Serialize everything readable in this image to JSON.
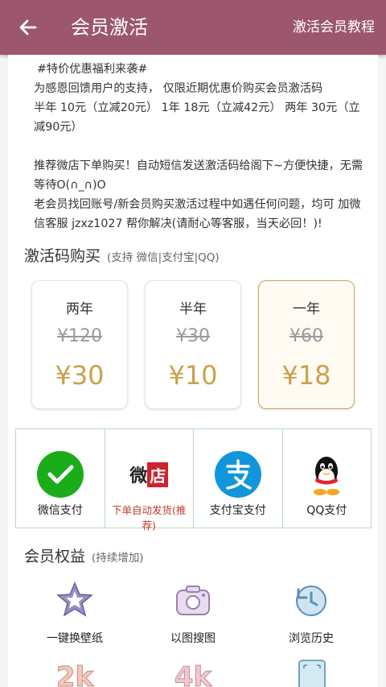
{
  "header": {
    "title": "会员激活",
    "tutorial_label": "激活会员教程"
  },
  "notice": {
    "lines": [
      "#特价优惠福利来袭#",
      "为感恩回馈用户的支持， 仅限近期优惠价购买会员激活码",
      "半年 10元（立减20元） 1年 18元（立减42元） 两年 30元（立减90元）",
      "推荐微店下单购买！自动短信发送激活码给阁下~方便快捷，无需等待O(∩_∩)O",
      "老会员找回账号/新会员购买激活过程中如遇任何问题，均可 加微信客服 jzxz1027 帮你解决(请耐心等客服，当天必回！)!"
    ]
  },
  "purchase": {
    "title": "激活码购买",
    "subtitle": "(支持 微信|支付宝|QQ)",
    "plans": [
      {
        "name": "两年",
        "original": "¥120",
        "price": "¥30"
      },
      {
        "name": "半年",
        "original": "¥30",
        "price": "¥10"
      },
      {
        "name": "一年",
        "original": "¥60",
        "price": "¥18"
      }
    ]
  },
  "payments": [
    {
      "label": "微信支付",
      "icon": "wechat-pay-icon"
    },
    {
      "label": "下单自动发货(推荐)",
      "icon": "weidian-icon",
      "icon_text": "微店"
    },
    {
      "label": "支付宝支付",
      "icon": "alipay-icon",
      "icon_text": "支"
    },
    {
      "label": "QQ支付",
      "icon": "qq-icon"
    }
  ],
  "benefits": {
    "title": "会员权益",
    "subtitle": "(持续增加)",
    "items": [
      {
        "label": "一键换壁纸",
        "icon": "wallpaper-icon"
      },
      {
        "label": "以图搜图",
        "icon": "camera-icon"
      },
      {
        "label": "浏览历史",
        "icon": "history-icon"
      }
    ],
    "partial_icons": [
      "2k",
      "4k",
      "phone"
    ]
  },
  "colors": {
    "header": "#9c566e",
    "accent_gold": "#c9a24a",
    "grid_border": "#b9dcb9",
    "recommend_red": "#c0392b"
  }
}
